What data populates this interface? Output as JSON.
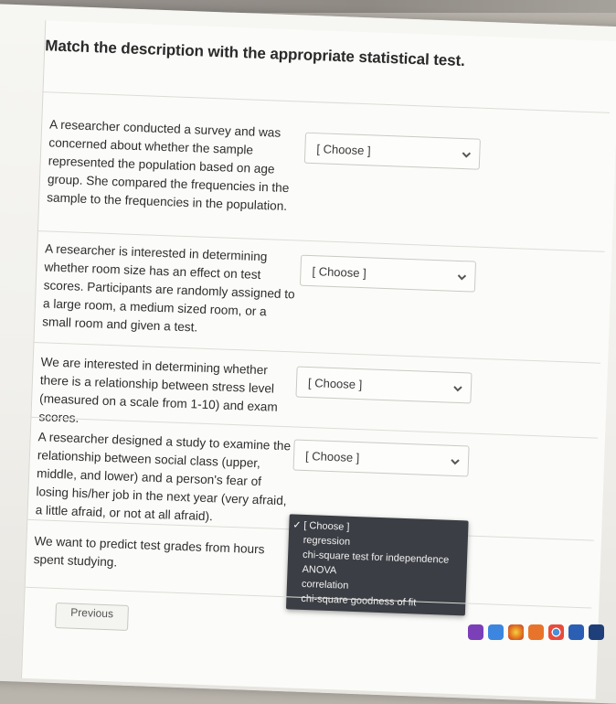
{
  "question": {
    "prompt": "Match the description with the appropriate statistical test."
  },
  "items": [
    {
      "description": "A researcher conducted a survey and was concerned about whether the sample represented the population based on age group. She compared the frequencies in the sample to the frequencies in the population.",
      "selected": "[ Choose ]"
    },
    {
      "description": "A researcher is interested in determining whether room size has an effect on test scores. Participants are randomly assigned to a large room, a medium sized room, or a small room and given a test.",
      "selected": "[ Choose ]"
    },
    {
      "description": "We are interested in determining whether there is a relationship between stress level (measured on a scale from 1-10) and exam scores.",
      "selected": "[ Choose ]"
    },
    {
      "description": "A researcher designed a study to examine the relationship between social class (upper, middle, and lower) and a person's fear of losing his/her job in the next year (very afraid, a little afraid, or not at all afraid).",
      "selected": "[ Choose ]"
    },
    {
      "description": "We want to predict test grades from hours spent studying.",
      "selected": "[ Choose ]"
    }
  ],
  "dropdown_options": [
    "[ Choose ]",
    "regression",
    "chi-square test for independence",
    "ANOVA",
    "correlation",
    "chi-square goodness of fit"
  ],
  "nav": {
    "previous_label": "Previous"
  },
  "colors": {
    "dropdown_bg": "#3b3e44",
    "card_bg": "#fbfbf9",
    "text": "#2d2d2d"
  },
  "dock_icons": [
    "app-icon-purple",
    "app-icon-blue",
    "photos-icon",
    "app-icon-orange",
    "chrome-icon",
    "word-icon",
    "app-icon-navy"
  ]
}
